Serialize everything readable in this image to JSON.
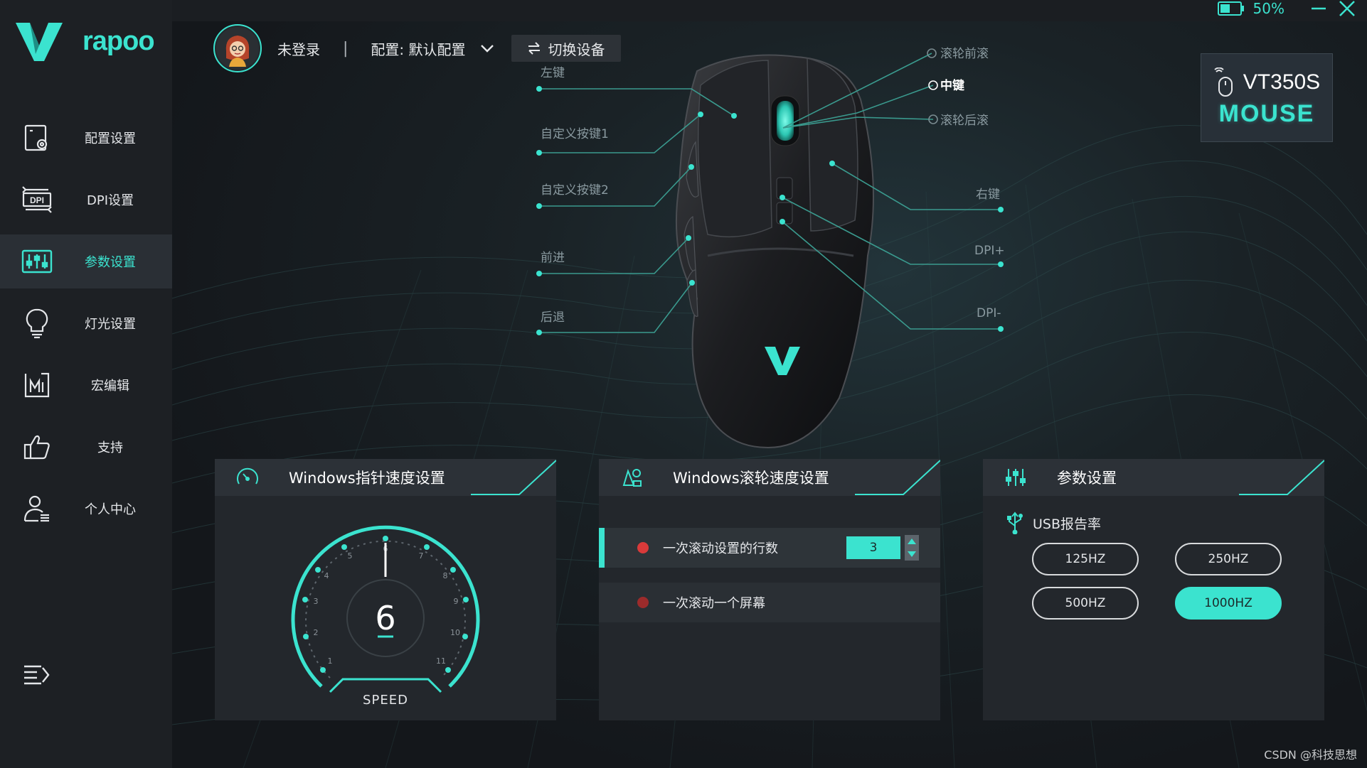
{
  "brand": {
    "logo_text": "rapoo",
    "accent": "#3be3cf"
  },
  "sidebar": {
    "items": [
      {
        "label": "配置设置",
        "icon": "config-icon",
        "active": false
      },
      {
        "label": "DPI设置",
        "icon": "dpi-icon",
        "active": false
      },
      {
        "label": "参数设置",
        "icon": "sliders-icon",
        "active": true
      },
      {
        "label": "灯光设置",
        "icon": "bulb-icon",
        "active": false
      },
      {
        "label": "宏编辑",
        "icon": "macro-icon",
        "active": false
      },
      {
        "label": "支持",
        "icon": "thumbs-up-icon",
        "active": false
      },
      {
        "label": "个人中心",
        "icon": "user-center-icon",
        "active": false
      }
    ],
    "menu_icon": "menu-icon"
  },
  "window": {
    "battery": "50%"
  },
  "header": {
    "login_status": "未登录",
    "separator": "|",
    "config_label": "配置: 默认配置",
    "switch_device": "切换设备"
  },
  "mouse_callouts": {
    "left_click": "左键",
    "custom1": "自定义按键1",
    "custom2": "自定义按键2",
    "forward": "前进",
    "back": "后退",
    "scroll_up": "滚轮前滚",
    "middle": "中键",
    "scroll_down": "滚轮后滚",
    "right_click": "右键",
    "dpi_plus": "DPI+",
    "dpi_minus": "DPI-"
  },
  "device": {
    "model": "VT350S",
    "type": "MOUSE"
  },
  "pointer_panel": {
    "title": "Windows指针速度设置",
    "speed_value": "6",
    "speed_label": "SPEED",
    "ticks": [
      "1",
      "2",
      "3",
      "4",
      "5",
      "6",
      "7",
      "8",
      "9",
      "10",
      "11"
    ]
  },
  "scroll_panel": {
    "title": "Windows滚轮速度设置",
    "option_lines": "一次滚动设置的行数",
    "lines_value": "3",
    "option_screen": "一次滚动一个屏幕"
  },
  "params_panel": {
    "title": "参数设置",
    "usb_label": "USB报告率",
    "rates": [
      "125HZ",
      "250HZ",
      "500HZ",
      "1000HZ"
    ],
    "selected_rate": "1000HZ"
  },
  "watermark": "CSDN @科技思想"
}
